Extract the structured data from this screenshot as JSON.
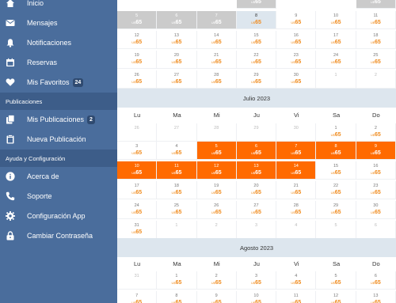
{
  "sidebar": {
    "items": [
      {
        "label": "Inicio",
        "icon": "home-icon",
        "badge": null
      },
      {
        "label": "Mensajes",
        "icon": "envelope-icon",
        "badge": null
      },
      {
        "label": "Notificaciones",
        "icon": "bell-icon",
        "badge": null
      },
      {
        "label": "Reservas",
        "icon": "calendar-icon",
        "badge": null
      },
      {
        "label": "Mis Favoritos",
        "icon": "heart-icon",
        "badge": "24"
      }
    ],
    "sections": [
      {
        "title": "Publicaciones",
        "items": [
          {
            "label": "Mis Publicaciones",
            "icon": "copy-icon",
            "badge": "2"
          },
          {
            "label": "Nueva Publicación",
            "icon": "clipboard-icon",
            "badge": null
          }
        ]
      },
      {
        "title": "Ayuda y Configuración",
        "items": [
          {
            "label": "Acerca de",
            "icon": "info-icon",
            "badge": null
          },
          {
            "label": "Soporte",
            "icon": "phone-icon",
            "badge": null
          },
          {
            "label": "Configuración App",
            "icon": "cog-icon",
            "badge": null
          },
          {
            "label": "Cambiar Contraseña",
            "icon": "lock-icon",
            "badge": null
          }
        ]
      }
    ]
  },
  "calendar": {
    "currency": "U$",
    "day_names": [
      "Lu",
      "Ma",
      "Mi",
      "Ju",
      "Vi",
      "Sa",
      "Do"
    ],
    "colors": {
      "booked": "#ff6a00",
      "blocked": "#cbcbcb",
      "price": "#f08c1f",
      "sidebar": "#4a6d9c"
    },
    "june_tail": {
      "top_row": [
        {
          "price": null,
          "state": "empty"
        },
        {
          "price": null,
          "state": "empty"
        },
        {
          "price": null,
          "state": "empty"
        },
        {
          "price": "65",
          "state": "blocked"
        },
        {
          "price": null,
          "state": "empty"
        },
        {
          "price": null,
          "state": "empty"
        },
        {
          "price": "65",
          "state": "blocked"
        }
      ],
      "weeks": [
        [
          {
            "day": "5",
            "state": "blocked"
          },
          {
            "day": "6",
            "state": "blocked"
          },
          {
            "day": "7",
            "state": "blocked"
          },
          {
            "day": "8",
            "state": "today"
          },
          {
            "day": "9",
            "state": "normal"
          },
          {
            "day": "10",
            "state": "normal"
          },
          {
            "day": "11",
            "state": "normal"
          }
        ],
        [
          {
            "day": "12",
            "state": "normal"
          },
          {
            "day": "13",
            "state": "normal"
          },
          {
            "day": "14",
            "state": "normal"
          },
          {
            "day": "15",
            "state": "normal"
          },
          {
            "day": "16",
            "state": "normal"
          },
          {
            "day": "17",
            "state": "normal"
          },
          {
            "day": "18",
            "state": "normal"
          }
        ],
        [
          {
            "day": "19",
            "state": "normal"
          },
          {
            "day": "20",
            "state": "normal"
          },
          {
            "day": "21",
            "state": "normal"
          },
          {
            "day": "22",
            "state": "normal"
          },
          {
            "day": "23",
            "state": "normal"
          },
          {
            "day": "24",
            "state": "normal"
          },
          {
            "day": "25",
            "state": "normal"
          }
        ],
        [
          {
            "day": "26",
            "state": "normal"
          },
          {
            "day": "27",
            "state": "normal"
          },
          {
            "day": "28",
            "state": "normal"
          },
          {
            "day": "29",
            "state": "normal"
          },
          {
            "day": "30",
            "state": "normal"
          },
          {
            "day": "1",
            "state": "other"
          },
          {
            "day": "2",
            "state": "other"
          }
        ]
      ]
    },
    "july": {
      "title": "Julio 2023",
      "weeks": [
        [
          {
            "day": "26",
            "state": "other"
          },
          {
            "day": "27",
            "state": "other"
          },
          {
            "day": "28",
            "state": "other"
          },
          {
            "day": "29",
            "state": "other"
          },
          {
            "day": "30",
            "state": "other"
          },
          {
            "day": "1",
            "state": "normal"
          },
          {
            "day": "2",
            "state": "normal"
          }
        ],
        [
          {
            "day": "3",
            "state": "normal"
          },
          {
            "day": "4",
            "state": "normal"
          },
          {
            "day": "5",
            "state": "booked"
          },
          {
            "day": "6",
            "state": "booked"
          },
          {
            "day": "7",
            "state": "booked"
          },
          {
            "day": "8",
            "state": "booked"
          },
          {
            "day": "9",
            "state": "booked"
          }
        ],
        [
          {
            "day": "10",
            "state": "booked"
          },
          {
            "day": "11",
            "state": "booked"
          },
          {
            "day": "12",
            "state": "booked"
          },
          {
            "day": "13",
            "state": "booked"
          },
          {
            "day": "14",
            "state": "booked"
          },
          {
            "day": "15",
            "state": "normal"
          },
          {
            "day": "16",
            "state": "normal"
          }
        ],
        [
          {
            "day": "17",
            "state": "normal"
          },
          {
            "day": "18",
            "state": "normal"
          },
          {
            "day": "19",
            "state": "normal"
          },
          {
            "day": "20",
            "state": "normal"
          },
          {
            "day": "21",
            "state": "normal"
          },
          {
            "day": "22",
            "state": "normal"
          },
          {
            "day": "23",
            "state": "normal"
          }
        ],
        [
          {
            "day": "24",
            "state": "normal"
          },
          {
            "day": "25",
            "state": "normal"
          },
          {
            "day": "26",
            "state": "normal"
          },
          {
            "day": "27",
            "state": "normal"
          },
          {
            "day": "28",
            "state": "normal"
          },
          {
            "day": "29",
            "state": "normal"
          },
          {
            "day": "30",
            "state": "normal"
          }
        ],
        [
          {
            "day": "31",
            "state": "normal"
          },
          {
            "day": "1",
            "state": "other"
          },
          {
            "day": "2",
            "state": "other"
          },
          {
            "day": "3",
            "state": "other"
          },
          {
            "day": "4",
            "state": "other"
          },
          {
            "day": "5",
            "state": "other"
          },
          {
            "day": "6",
            "state": "other"
          }
        ]
      ]
    },
    "august": {
      "title": "Agosto 2023",
      "weeks": [
        [
          {
            "day": "31",
            "state": "other"
          },
          {
            "day": "1",
            "state": "normal"
          },
          {
            "day": "2",
            "state": "normal"
          },
          {
            "day": "3",
            "state": "normal"
          },
          {
            "day": "4",
            "state": "normal"
          },
          {
            "day": "5",
            "state": "normal"
          },
          {
            "day": "6",
            "state": "normal"
          }
        ],
        [
          {
            "day": "7",
            "state": "normal"
          },
          {
            "day": "8",
            "state": "normal"
          },
          {
            "day": "9",
            "state": "normal"
          },
          {
            "day": "10",
            "state": "normal"
          },
          {
            "day": "11",
            "state": "normal"
          },
          {
            "day": "12",
            "state": "normal"
          },
          {
            "day": "13",
            "state": "normal"
          }
        ]
      ]
    },
    "price": "65"
  }
}
